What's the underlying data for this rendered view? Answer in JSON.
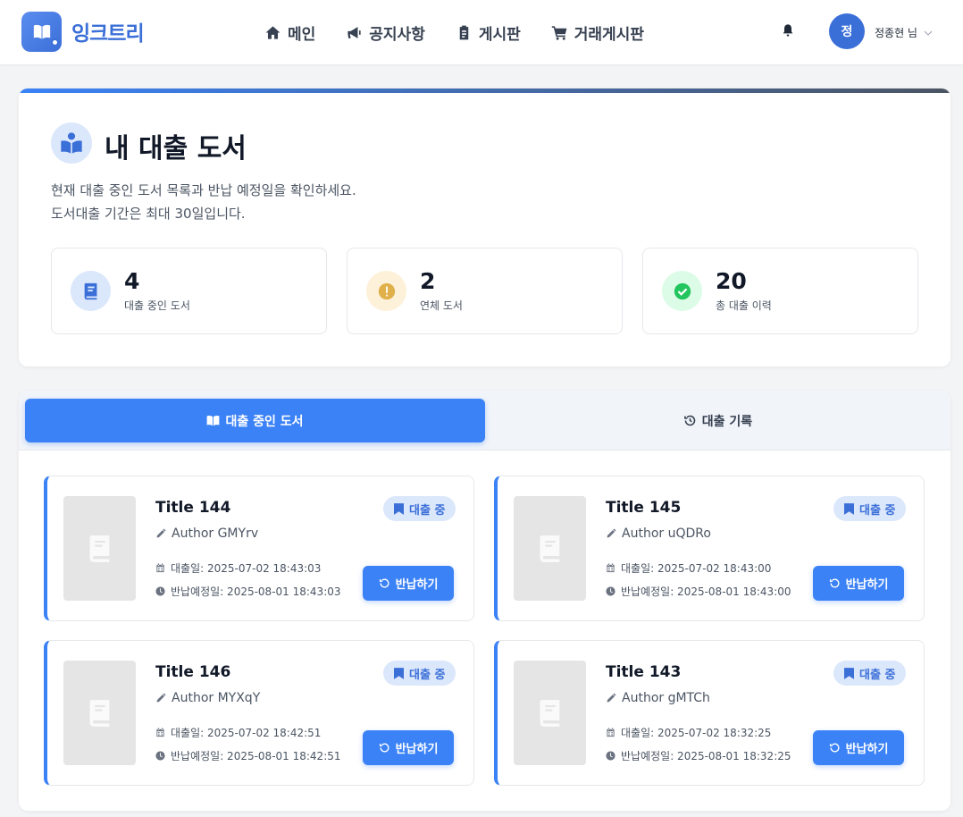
{
  "app": {
    "logo_text": "잉크트리"
  },
  "nav": {
    "items": [
      {
        "label": "메인",
        "icon": "home-icon"
      },
      {
        "label": "공지사항",
        "icon": "megaphone-icon"
      },
      {
        "label": "게시판",
        "icon": "clipboard-icon"
      },
      {
        "label": "거래게시판",
        "icon": "cart-icon"
      }
    ]
  },
  "user": {
    "avatar_initial": "정",
    "name": "정종현 님"
  },
  "header": {
    "title": "내 대출 도서",
    "desc_line1": "현재 대출 중인 도서 목록과 반납 예정일을 확인하세요.",
    "desc_line2": "도서대출 기간은 최대 30일입니다."
  },
  "stats": [
    {
      "value": "4",
      "label": "대출 중인 도서",
      "icon": "book-icon",
      "color": "#3b6fd8",
      "bg": "#dbe7fb"
    },
    {
      "value": "2",
      "label": "연체 도서",
      "icon": "warning-icon",
      "color": "#e0b04a",
      "bg": "#fdf1da"
    },
    {
      "value": "20",
      "label": "총 대출 이력",
      "icon": "check-circle-icon",
      "color": "#22c55e",
      "bg": "#dcfce7"
    }
  ],
  "tabs": {
    "active_label": "대출 중인 도서",
    "inactive_label": "대출 기록"
  },
  "books": [
    {
      "title": "Title 144",
      "author": "Author GMYrv",
      "loan_date": "대출일: 2025-07-02 18:43:03",
      "due_date": "반납예정일: 2025-08-01 18:43:03",
      "badge": "대출 중",
      "return_label": "반납하기"
    },
    {
      "title": "Title 145",
      "author": "Author uQDRo",
      "loan_date": "대출일: 2025-07-02 18:43:00",
      "due_date": "반납예정일: 2025-08-01 18:43:00",
      "badge": "대출 중",
      "return_label": "반납하기"
    },
    {
      "title": "Title 146",
      "author": "Author MYXqY",
      "loan_date": "대출일: 2025-07-02 18:42:51",
      "due_date": "반납예정일: 2025-08-01 18:42:51",
      "badge": "대출 중",
      "return_label": "반납하기"
    },
    {
      "title": "Title 143",
      "author": "Author gMTCh",
      "loan_date": "대출일: 2025-07-02 18:32:25",
      "due_date": "반납예정일: 2025-08-01 18:32:25",
      "badge": "대출 중",
      "return_label": "반납하기"
    }
  ],
  "colors": {
    "accent": "#3b82f6",
    "brand": "#3b6fd8"
  }
}
